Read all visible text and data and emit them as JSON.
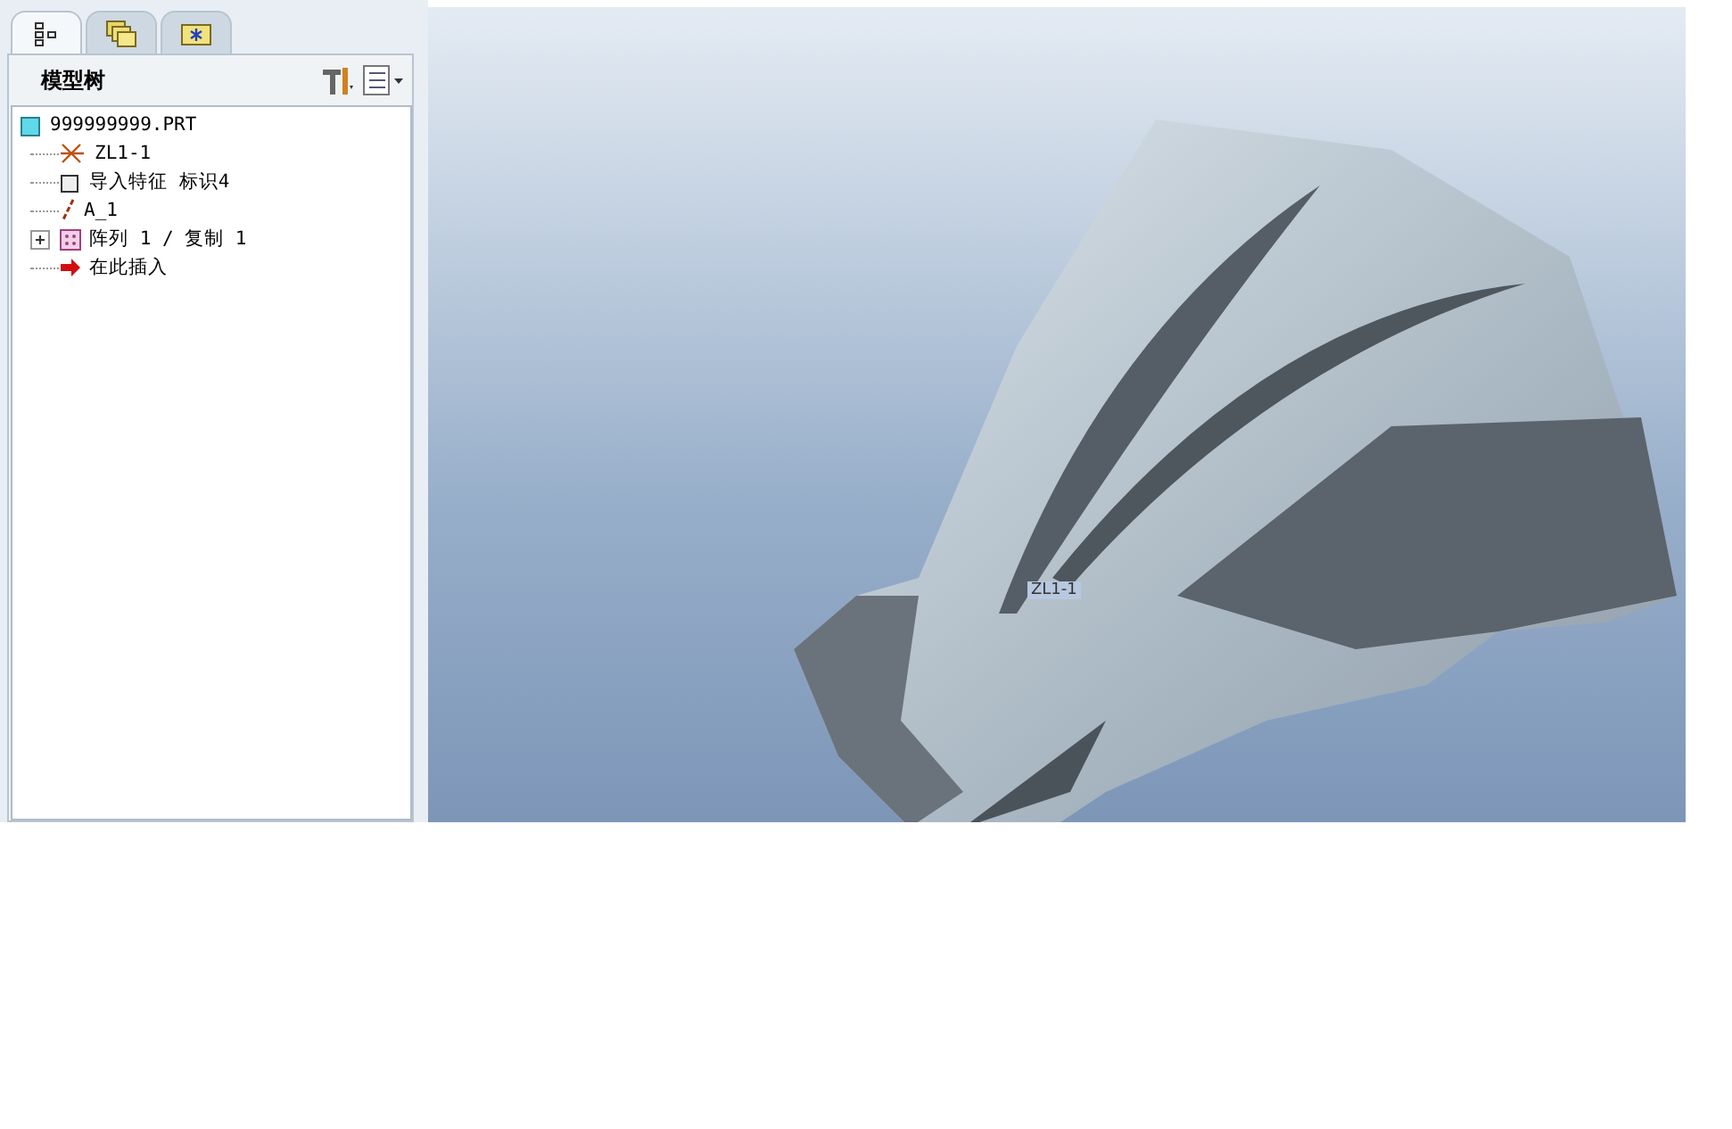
{
  "panel": {
    "tabs": [
      {
        "kind": "tree",
        "selected": true
      },
      {
        "kind": "layers",
        "selected": false
      },
      {
        "kind": "favorites",
        "selected": false
      }
    ],
    "title": "模型树"
  },
  "tree": {
    "label": "999999999.PRT",
    "kind": "part",
    "children": [
      {
        "label": "ZL1-1",
        "kind": "csys"
      },
      {
        "label": "导入特征 标识4",
        "kind": "import"
      },
      {
        "label": "A_1",
        "kind": "axis"
      },
      {
        "label": "阵列 1 / 复制 1",
        "kind": "pattern",
        "expanded": false
      },
      {
        "label": "在此插入",
        "kind": "insert"
      }
    ]
  },
  "viewport": {
    "csys_label": "ZL1-1"
  }
}
